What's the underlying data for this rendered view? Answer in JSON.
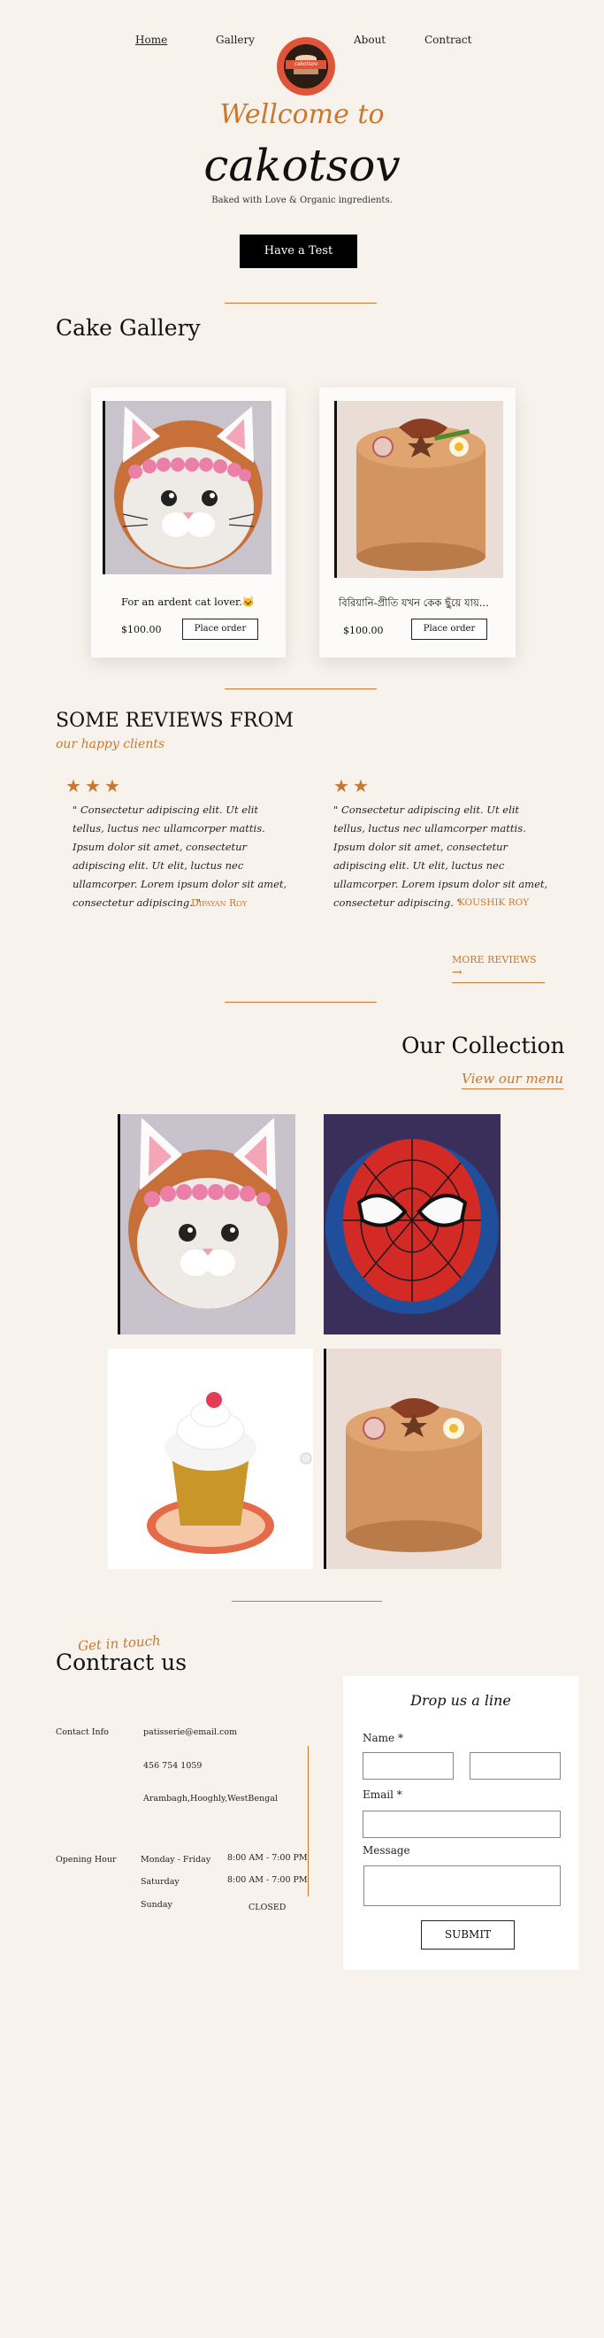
{
  "nav": {
    "home": "Home",
    "gallery": "Gallery",
    "about": "About",
    "contract": "Contract",
    "logo_text": "cakotsov"
  },
  "hero": {
    "welcome": "Wellcome to",
    "brand": "cakotsov",
    "tagline": "Baked with Love & Organic ingredients.",
    "cta": "Have a Test"
  },
  "gallery": {
    "title": "Cake Gallery",
    "cards": [
      {
        "caption": "For an ardent cat lover.🐱",
        "price": "$100.00",
        "button": "Place order"
      },
      {
        "caption": "বিরিয়ানি-প্রীতি যখন কেক ছুঁয়ে যায়...",
        "price": "$100.00",
        "button": "Place order"
      }
    ]
  },
  "reviews": {
    "title": "SOME REVIEWS FROM",
    "subtitle": "our happy clients",
    "items": [
      {
        "stars": 3,
        "text": "\" Consectetur adipiscing elit. Ut elit tellus, luctus nec ullamcorper mattis. Ipsum dolor sit amet, consectetur adipiscing elit. Ut elit, luctus nec ullamcorper. Lorem ipsum dolor sit amet, consectetur adipiscing. \"",
        "author": "Dipayan Roy"
      },
      {
        "stars": 2,
        "text": "\" Consectetur adipiscing elit. Ut elit tellus, luctus nec ullamcorper mattis. Ipsum dolor sit amet, consectetur adipiscing elit. Ut elit, luctus nec ullamcorper. Lorem ipsum dolor sit amet, consectetur adipiscing. \"",
        "author": "KOUSHIK ROY"
      }
    ],
    "more": "MORE REVIEWS"
  },
  "collection": {
    "title": "Our Collection",
    "link": "View our menu"
  },
  "contact": {
    "kicker": "Get in touch",
    "title": "Contract us",
    "info_label": "Contact Info",
    "email": "patisserie@email.com",
    "phone": "456 754 1059",
    "address": "Arambagh,Hooghly,WestBengal",
    "hours_label": "Opening Hour",
    "hours": [
      {
        "day": "Monday - Friday",
        "time": "8:00 AM - 7:00 PM"
      },
      {
        "day": "Saturday",
        "time": "8:00 AM - 7:00 PM"
      },
      {
        "day": "Sunday",
        "time": "CLOSED"
      }
    ]
  },
  "form": {
    "title": "Drop us a line",
    "name_label": "Name *",
    "email_label": "Email *",
    "message_label": "Message",
    "submit": "SUBMIT"
  },
  "colors": {
    "background": "#f8f2ec",
    "accent": "#c9782f",
    "dark": "#111111"
  }
}
